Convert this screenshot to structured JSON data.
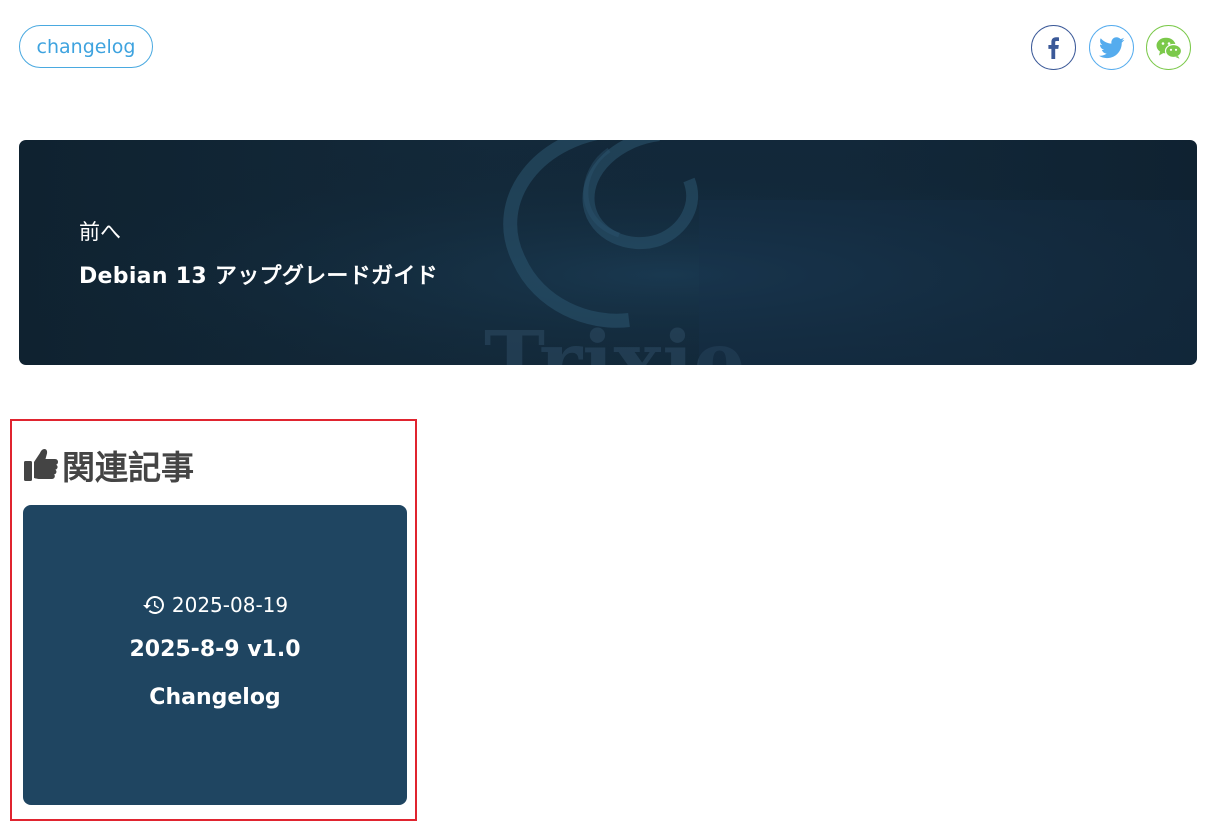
{
  "tag": {
    "label": "changelog"
  },
  "share": {
    "facebook_icon": "facebook-icon",
    "twitter_icon": "twitter-icon",
    "wechat_icon": "wechat-icon",
    "colors": {
      "facebook": "#3b5998",
      "twitter": "#55acee",
      "wechat": "#7bc94a"
    }
  },
  "prev_post": {
    "label": "前へ",
    "title": "Debian 13 アップグレードガイド"
  },
  "related": {
    "heading": "関連記事",
    "heading_icon": "thumbs-up-icon",
    "cards": [
      {
        "date": "2025-08-19",
        "date_icon": "history-icon",
        "title_line1": "2025-8-9 v1.0",
        "title_line2": "Changelog"
      }
    ]
  }
}
